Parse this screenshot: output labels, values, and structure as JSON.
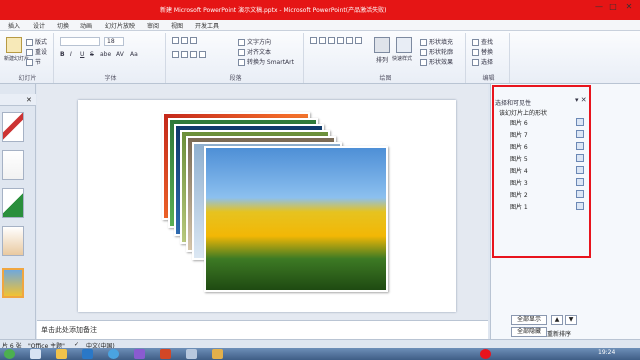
{
  "window": {
    "title": "新建 Microsoft PowerPoint 演示文稿.pptx - Microsoft PowerPoint(产品激活失败)",
    "controls": [
      "—",
      "□",
      "✕"
    ]
  },
  "menu": {
    "tabs": [
      "插入",
      "设计",
      "切换",
      "动画",
      "幻灯片放映",
      "审阅",
      "视图",
      "开发工具"
    ]
  },
  "ribbon": {
    "slides_group": {
      "label": "幻灯片",
      "new_slide": "新建幻灯片",
      "layout": "版式",
      "reset": "重设",
      "section": "节"
    },
    "font_group": {
      "label": "字体",
      "size": "18",
      "bold": "B",
      "italic": "I",
      "underline": "U",
      "strike": "S",
      "shadow": "abe",
      "spacing": "AV",
      "case": "Aa"
    },
    "paragraph_group": {
      "label": "段落",
      "text_direction": "文字方向",
      "align_text": "对齐文本",
      "smartart": "转换为 SmartArt"
    },
    "drawing_group": {
      "label": "绘图",
      "arrange": "排列",
      "quick_styles": "快速样式",
      "shape_fill": "形状填充",
      "shape_outline": "形状轮廓",
      "shape_effects": "形状效果"
    },
    "editing_group": {
      "label": "编辑",
      "find": "查找",
      "replace": "替换",
      "select": "选择"
    }
  },
  "slide_notes": "单击此处添加备注",
  "selection_pane": {
    "title": "选择和可见性",
    "subtitle": "该幻灯片上的形状",
    "items": [
      "图片 6",
      "图片 7",
      "图片 6",
      "图片 5",
      "图片 4",
      "图片 3",
      "图片 2",
      "图片 1"
    ],
    "show_all": "全部显示",
    "hide_all": "全部隐藏",
    "reorder": "重新排序"
  },
  "status": {
    "slide_info": "片 6 张",
    "theme": "\"Office 主题\"",
    "language": "中文(中国)"
  },
  "taskbar": {
    "time": "19:24"
  },
  "colors": {
    "title_bar": "#e51515",
    "highlight_border": "#e8141d"
  }
}
